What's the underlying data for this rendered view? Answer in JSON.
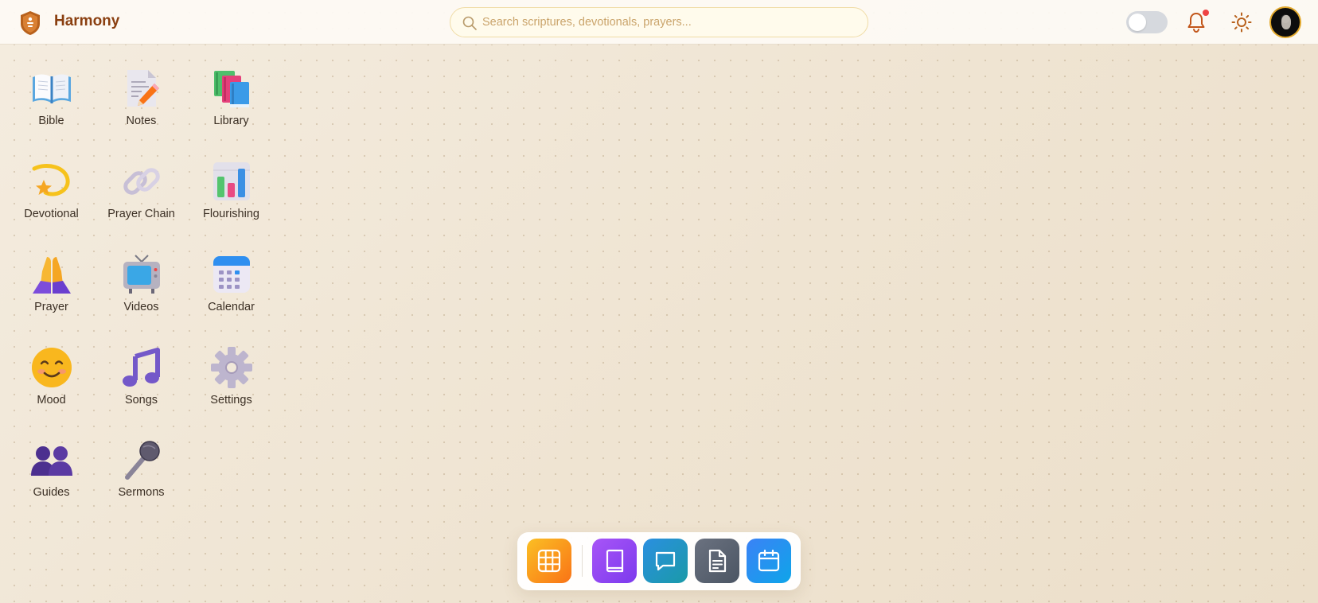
{
  "header": {
    "app_name": "Harmony",
    "search_placeholder": "Search scriptures, devotionals, prayers...",
    "theme_toggle_on": false,
    "notifications_unread": true
  },
  "apps": [
    {
      "label": "Bible",
      "icon": "open-book-icon"
    },
    {
      "label": "Notes",
      "icon": "notepad-pencil-icon"
    },
    {
      "label": "Library",
      "icon": "books-icon"
    },
    {
      "label": "Devotional",
      "icon": "dizzy-star-icon"
    },
    {
      "label": "Prayer Chain",
      "icon": "chain-link-icon"
    },
    {
      "label": "Flourishing",
      "icon": "bar-chart-icon"
    },
    {
      "label": "Prayer",
      "icon": "praying-hands-icon"
    },
    {
      "label": "Videos",
      "icon": "television-icon"
    },
    {
      "label": "Calendar",
      "icon": "calendar-icon"
    },
    {
      "label": "Mood",
      "icon": "smiling-face-icon"
    },
    {
      "label": "Songs",
      "icon": "music-note-icon"
    },
    {
      "label": "Settings",
      "icon": "gear-icon"
    },
    {
      "label": "Guides",
      "icon": "people-icon"
    },
    {
      "label": "Sermons",
      "icon": "microphone-icon"
    }
  ],
  "dock": [
    {
      "name": "apps",
      "icon": "grid-icon",
      "color": "#f59e0b"
    },
    {
      "name": "bible",
      "icon": "book-icon",
      "color": "#8b5cf6"
    },
    {
      "name": "chat",
      "icon": "chat-bubble-icon",
      "color": "#1e88d6"
    },
    {
      "name": "notes",
      "icon": "document-icon",
      "color": "#5b6474"
    },
    {
      "name": "calendar",
      "icon": "calendar-icon",
      "color": "#1e90f0"
    }
  ],
  "colors": {
    "brand": "#8a3f10",
    "background": "#f1e8da",
    "notification_dot": "#ef4444",
    "avatar_ring": "#e2a82b"
  }
}
